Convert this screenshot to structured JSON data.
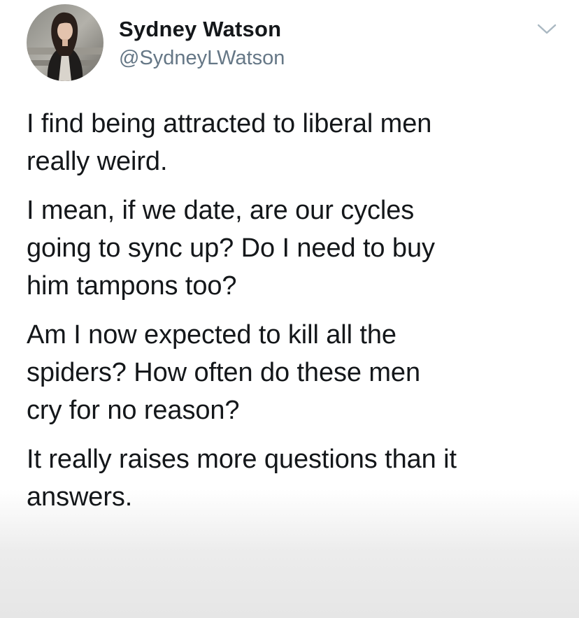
{
  "tweet": {
    "author": {
      "display_name": "Sydney Watson",
      "handle": "@SydneyLWatson",
      "avatar_icon": "profile-photo-avatar"
    },
    "menu_icon": "chevron-down-icon",
    "paragraphs": [
      {
        "lines": [
          "I find being attracted to liberal men",
          "really weird."
        ]
      },
      {
        "lines": [
          "I mean, if we date, are our cycles",
          "going to sync up? Do I need to buy",
          "him tampons too?"
        ]
      },
      {
        "lines": [
          "Am I now expected to kill all the",
          "spiders? How often do these men",
          "cry for no reason?"
        ]
      },
      {
        "lines": [
          "It really raises more questions than it",
          "answers."
        ]
      }
    ]
  },
  "colors": {
    "text_primary": "#14171a",
    "text_secondary": "#657786",
    "chevron": "#aab8c2"
  }
}
